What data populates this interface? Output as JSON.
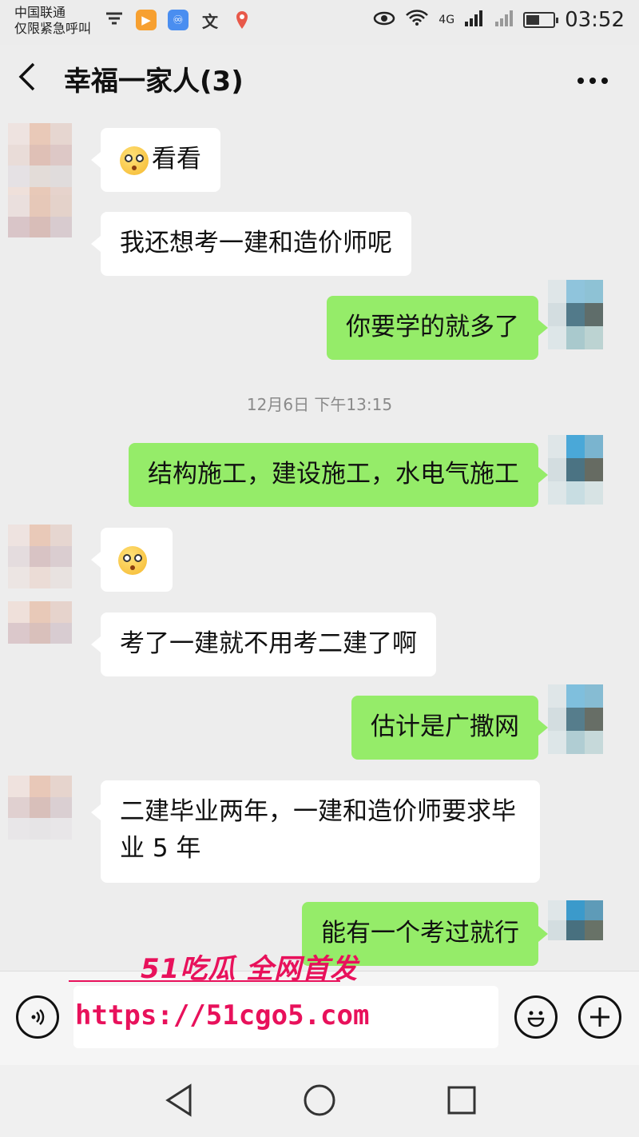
{
  "status_bar": {
    "carrier_line1": "中国联通",
    "carrier_line2": "仅限紧急呼叫",
    "network_label": "4G",
    "time": "03:52",
    "battery_level": 0.5
  },
  "header": {
    "back_icon": "chevron-left-icon",
    "title": "幸福一家人(3)",
    "more_icon": "more-dots-icon"
  },
  "messages": [
    {
      "side": "left",
      "emoji": true,
      "text": "看看"
    },
    {
      "side": "left",
      "emoji": false,
      "text": "我还想考一建和造价师呢"
    },
    {
      "side": "right",
      "emoji": false,
      "text": "你要学的就多了"
    },
    {
      "type": "timestamp",
      "text": "12月6日 下午13:15"
    },
    {
      "side": "right",
      "emoji": false,
      "text": "结构施工，建设施工，水电气施工"
    },
    {
      "side": "left",
      "emoji": true,
      "text": ""
    },
    {
      "side": "left",
      "emoji": false,
      "text": "考了一建就不用考二建了啊"
    },
    {
      "side": "right",
      "emoji": false,
      "text": "估计是广撒网"
    },
    {
      "side": "left",
      "emoji": false,
      "text": "二建毕业两年，一建和造价师要求毕业 5 年"
    },
    {
      "side": "right",
      "emoji": false,
      "text": "能有一个考过就行"
    }
  ],
  "input_bar": {
    "voice_icon": "voice-icon",
    "emoji_icon": "emoji-icon",
    "plus_icon": "plus-icon",
    "text_value": ""
  },
  "watermark": {
    "logo_text": "51吃瓜 全网首发",
    "url": "https://51cgo5.com"
  },
  "nav_bar": {
    "back_icon": "triangle-back-icon",
    "home_icon": "circle-home-icon",
    "recent_icon": "square-recents-icon"
  },
  "colors": {
    "own_bubble": "#95ec69",
    "other_bubble": "#ffffff",
    "background": "#ededed",
    "watermark": "#e8115b"
  }
}
